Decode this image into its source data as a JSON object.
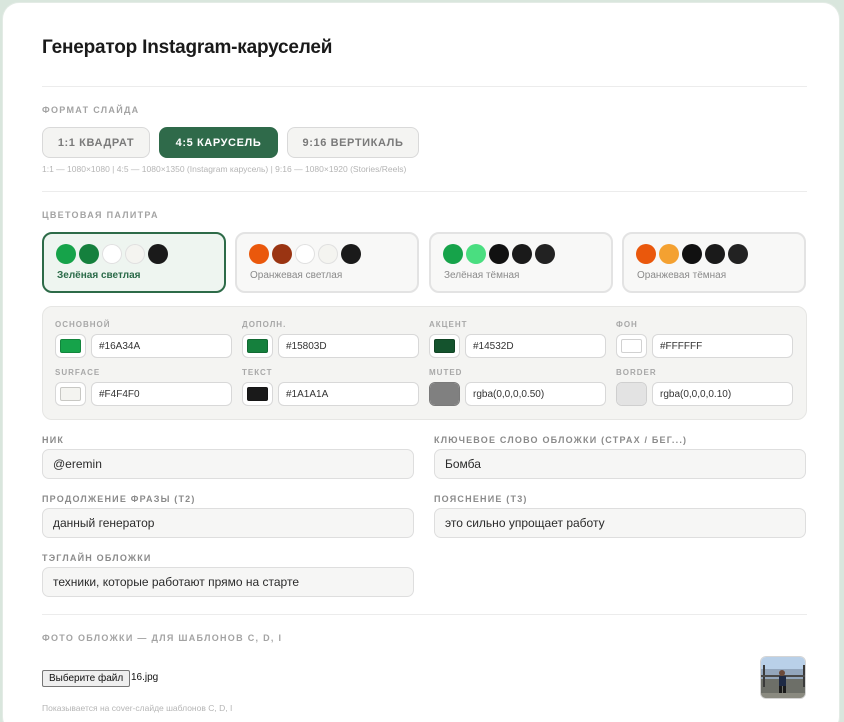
{
  "app": {
    "title": "Генератор Instagram-каруселей"
  },
  "format": {
    "label": "ФОРМАТ СЛАЙДА",
    "buttons": [
      {
        "label": "1:1 КВАДРАТ",
        "active": false
      },
      {
        "label": "4:5 КАРУСЕЛЬ",
        "active": true
      },
      {
        "label": "9:16 ВЕРТИКАЛЬ",
        "active": false
      }
    ],
    "hint": "1:1 — 1080×1080  |  4:5 — 1080×1350 (Instagram карусель)  |  9:16 — 1080×1920 (Stories/Reels)"
  },
  "palette": {
    "label": "ЦВЕТОВАЯ ПАЛИТРА",
    "presets": [
      {
        "name": "Зелёная светлая",
        "active": true,
        "colors": [
          "#16A34A",
          "#15803D",
          "#FFFFFF",
          "#F4F4F0",
          "#1A1A1A"
        ]
      },
      {
        "name": "Оранжевая светлая",
        "active": false,
        "colors": [
          "#EA580C",
          "#9A3412",
          "#FFFFFF",
          "#F4F4F0",
          "#1A1A1A"
        ]
      },
      {
        "name": "Зелёная тёмная",
        "active": false,
        "colors": [
          "#16A34A",
          "#4ADE80",
          "#111111",
          "#1A1A1A",
          "#222222"
        ]
      },
      {
        "name": "Оранжевая тёмная",
        "active": false,
        "colors": [
          "#EA580C",
          "#F4A131",
          "#111111",
          "#1A1A1A",
          "#222222"
        ]
      }
    ],
    "colors": [
      {
        "label": "ОСНОВНОЙ",
        "value": "#16A34A",
        "swatch": "#16A34A"
      },
      {
        "label": "ДОПОЛН.",
        "value": "#15803D",
        "swatch": "#15803D"
      },
      {
        "label": "АКЦЕНТ",
        "value": "#14532D",
        "swatch": "#14532D"
      },
      {
        "label": "ФОН",
        "value": "#FFFFFF",
        "swatch": "#FFFFFF"
      },
      {
        "label": "SURFACE",
        "value": "#F4F4F0",
        "swatch": "#F4F4F0"
      },
      {
        "label": "ТЕКСТ",
        "value": "#1A1A1A",
        "swatch": "#1A1A1A"
      },
      {
        "label": "MUTED",
        "value": "rgba(0,0,0,0.50)",
        "swatch": "#808080"
      },
      {
        "label": "BORDER",
        "value": "rgba(0,0,0,0.10)",
        "swatch": "#E3E3E3"
      }
    ]
  },
  "fields": {
    "nick": {
      "label": "НИК",
      "value": "@eremin"
    },
    "cover_keyword": {
      "label": "КЛЮЧЕВОЕ СЛОВО ОБЛОЖКИ (СТРАХ / БЕГ...)",
      "value": "Бомба"
    },
    "continuation": {
      "label": "ПРОДОЛЖЕНИЕ ФРАЗЫ (Т2)",
      "value": "данный генератор"
    },
    "explanation": {
      "label": "ПОЯСНЕНИЕ (Т3)",
      "value": "это сильно упрощает работу"
    },
    "tagline": {
      "label": "ТЭГЛАЙН ОБЛОЖКИ",
      "value": "техники, которые работают прямо на старте"
    }
  },
  "photo": {
    "label": "ФОТО ОБЛОЖКИ — ДЛЯ ШАБЛОНОВ C, D, I",
    "button_label": "Выберите файл",
    "file_name": "16.jpg",
    "hint": "Показывается на cover-слайде шаблонов C, D, I"
  }
}
